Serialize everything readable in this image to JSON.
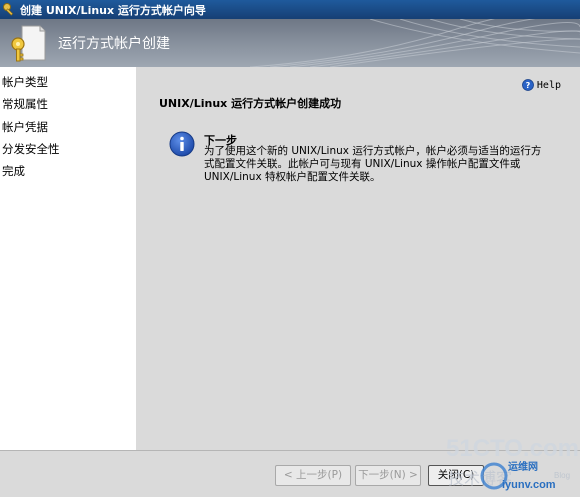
{
  "window": {
    "title": "创建 UNIX/Linux 运行方式帐户向导"
  },
  "header": {
    "title": "运行方式帐户创建"
  },
  "sidebar": {
    "items": [
      {
        "label": "帐户类型"
      },
      {
        "label": "常规属性"
      },
      {
        "label": "帐户凭据"
      },
      {
        "label": "分发安全性"
      },
      {
        "label": "完成"
      }
    ]
  },
  "main": {
    "help_label": "Help",
    "heading": "UNIX/Linux 运行方式帐户创建成功",
    "next_title": "下一步",
    "next_text": "为了使用这个新的 UNIX/Linux 运行方式帐户，帐户必须与适当的运行方式配置文件关联。此帐户可与现有 UNIX/Linux 操作帐户配置文件或 UNIX/Linux 特权帐户配置文件关联。"
  },
  "footer": {
    "prev_label": "< 上一步(P)",
    "next_label": "下一步(N) >",
    "create_label": "关闭(C)"
  },
  "watermark": {
    "site": "51CTO.com",
    "sub": "技术博客",
    "brand": "运维网",
    "url": "iyunv.com",
    "blog": "Blog"
  },
  "colors": {
    "titlebar": "#1f5a9c",
    "header": "#858e9b",
    "panel": "#dadada",
    "info_blue": "#2457b8"
  }
}
